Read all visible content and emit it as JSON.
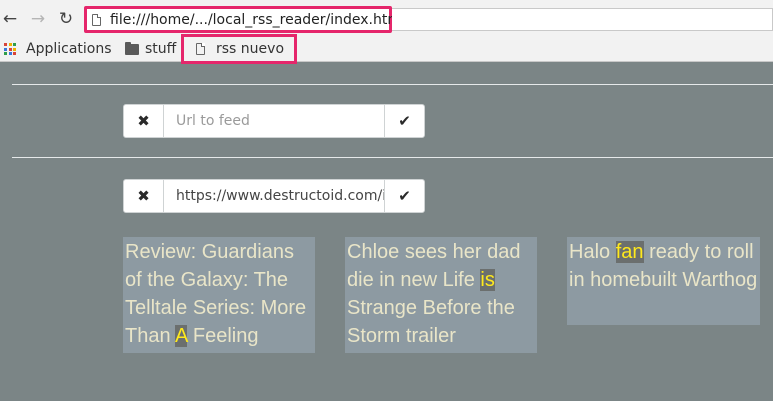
{
  "browser": {
    "url": "file:///home/.../local_rss_reader/index.html",
    "bookmarks": [
      {
        "label": "Applications",
        "icon": "apps-grid-icon"
      },
      {
        "label": "stuff",
        "icon": "folder-icon"
      },
      {
        "label": "rss nuevo",
        "icon": "page-icon"
      }
    ]
  },
  "forms": [
    {
      "placeholder": "Url to feed",
      "value": ""
    },
    {
      "placeholder": "",
      "value": "https://www.destructoid.com/ind"
    }
  ],
  "articles": [
    {
      "before": "Review: Guardians of the Galaxy: The Telltale Series: More Than ",
      "highlight": "A",
      "after": " Feeling"
    },
    {
      "before": "Chloe sees her dad die in new Life ",
      "highlight": "is",
      "after": " Strange Before the Storm trailer"
    },
    {
      "before": "Halo ",
      "highlight": "fan",
      "after": " ready to roll in homebuilt Warthog"
    }
  ],
  "colors": {
    "page_background": "#7b8586",
    "card_background": "#8d9aa2",
    "card_text": "#e9e5c8",
    "highlight_text": "#ffe91c",
    "annotation_border": "#e5266b"
  }
}
